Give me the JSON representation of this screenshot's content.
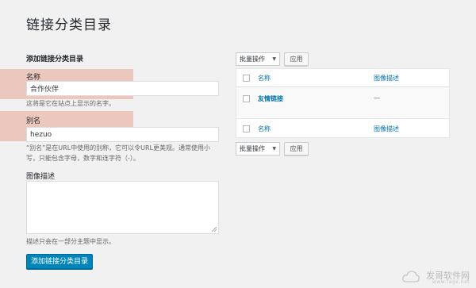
{
  "page": {
    "title": "链接分类目录"
  },
  "form": {
    "section_title": "添加链接分类目录",
    "name": {
      "label": "名称",
      "value": "合作伙伴",
      "hint": "这将是它在站点上显示的名字。"
    },
    "slug": {
      "label": "别名",
      "value": "hezuo",
      "hint_line1": "“别名”是在URL中使用的别称，它可以令URL更美观。通常使用小",
      "hint_line2": "写，只能包含字母，数字和连字符（-）。"
    },
    "description": {
      "label": "图像描述",
      "value": "",
      "hint": "描述只会在一部分主题中显示。"
    },
    "submit_label": "添加链接分类目录"
  },
  "bulk_top": {
    "select_value": "批量操作",
    "apply_label": "应用"
  },
  "table": {
    "header": {
      "name": "名称",
      "description": "图像描述"
    },
    "rows": [
      {
        "name": "友情链接",
        "description": "—"
      }
    ],
    "footer": {
      "name": "名称",
      "description": "图像描述"
    }
  },
  "bulk_bottom": {
    "select_value": "批量操作",
    "apply_label": "应用"
  },
  "colors": {
    "accent": "#0085ba",
    "link": "#0073aa",
    "highlight": "#e48c76"
  },
  "watermark": {
    "text": "发哥软件网",
    "url": "www.fage.net"
  }
}
